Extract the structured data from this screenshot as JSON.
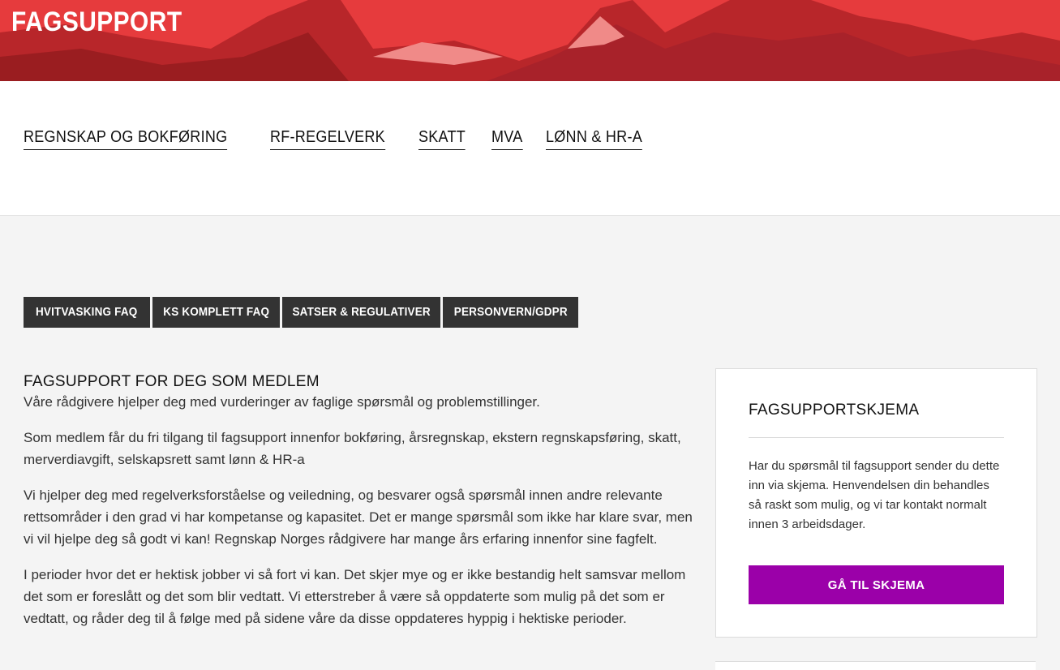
{
  "header": {
    "title": "FAGSUPPORT",
    "banner_color": "#e63b3d"
  },
  "topnav": {
    "links": [
      "REGNSKAP OG BOKFØRING",
      "RF-REGELVERK",
      "SKATT",
      "MVA",
      "LØNN & HR-A"
    ]
  },
  "tabs": [
    "HVITVASKING FAQ",
    "KS KOMPLETT FAQ",
    "SATSER & REGULATIVER",
    "PERSONVERN/GDPR"
  ],
  "main": {
    "heading": "FAGSUPPORT FOR DEG SOM MEDLEM",
    "paragraphs": [
      "Våre rådgivere hjelper deg med vurderinger av faglige spørsmål og problemstillinger.",
      "Som medlem får du fri tilgang til fagsupport innenfor bokføring, årsregnskap, ekstern regnskapsføring, skatt, merverdiavgift, selskapsrett samt lønn & HR-a",
      "Vi hjelper deg med regelverksforståelse og veiledning, og besvarer også spørsmål innen andre relevante rettsområder i den grad vi har kompetanse og kapasitet. Det er mange spørsmål som ikke har klare svar, men vi vil hjelpe deg så godt vi kan! Regnskap Norges rådgivere har mange års erfaring innenfor sine fagfelt.",
      "I perioder hvor det er hektisk jobber vi så fort vi kan. Det skjer mye og er ikke bestandig helt samsvar mellom det som er foreslått og det som blir vedtatt. Vi etterstreber å være så oppdaterte som mulig på det som er vedtatt, og råder deg til å følge med på sidene våre da disse oppdateres hyppig i hektiske perioder."
    ]
  },
  "sidebar": {
    "title": "FAGSUPPORTSKJEMA",
    "text": "Har du spørsmål til fagsupport sender du dette inn via skjema. Henvendelsen din behandles så raskt som mulig, og vi tar kontakt normalt innen 3 arbeidsdager.",
    "button_label": "GÅ TIL SKJEMA",
    "button_color": "#9b00a9"
  }
}
